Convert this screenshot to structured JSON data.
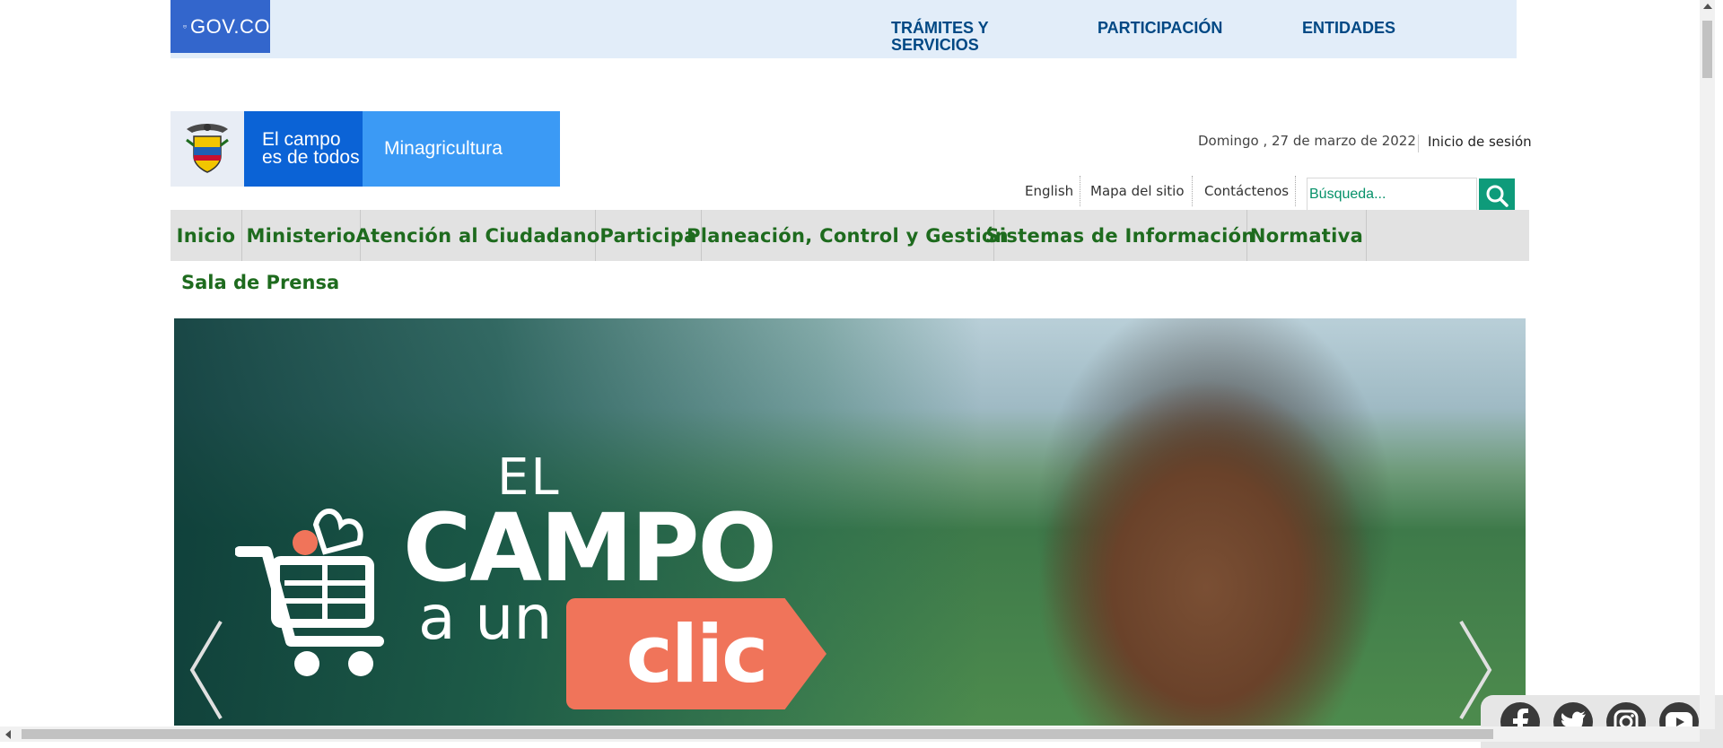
{
  "gov_bar": {
    "logo_text": "GOV.CO",
    "links": [
      {
        "label": "TRÁMITES Y SERVICIOS"
      },
      {
        "label": "PARTICIPACIÓN"
      },
      {
        "label": "ENTIDADES"
      }
    ],
    "background": "#e2edf9",
    "logo_color": "#3366cc"
  },
  "brand": {
    "slogan": "El campo es de todos",
    "slogan_line1": "El campo",
    "slogan_line2": "es de todos",
    "ministry": "Minagricultura"
  },
  "header": {
    "date": "Domingo , 27 de marzo de 2022",
    "login": "Inicio de sesión",
    "links": [
      {
        "label": "English"
      },
      {
        "label": "Mapa del sitio"
      },
      {
        "label": "Contáctenos"
      }
    ],
    "search": {
      "placeholder": "Búsqueda...",
      "value": "",
      "button_icon": "search-icon"
    }
  },
  "menu": {
    "items": [
      {
        "label": "Inicio"
      },
      {
        "label": "Ministerio"
      },
      {
        "label": "Atención al Ciudadano"
      },
      {
        "label": "Participa"
      },
      {
        "label": "Planeación, Control y Gestión"
      },
      {
        "label": "Sistemas de Información"
      },
      {
        "label": "Normativa"
      }
    ],
    "second_row": "Sala de Prensa",
    "text_color": "#1e6b1e",
    "background": "#e2e2e2"
  },
  "hero": {
    "line_el": "EL",
    "line_campo": "CAMPO",
    "line_aun": "a un",
    "line_clic": "clic",
    "prev_icon": "chevron-left-icon",
    "next_icon": "chevron-right-icon",
    "accent": "#f0745a"
  },
  "social": {
    "icons": [
      "facebook-icon",
      "twitter-icon",
      "instagram-icon",
      "youtube-icon"
    ]
  }
}
